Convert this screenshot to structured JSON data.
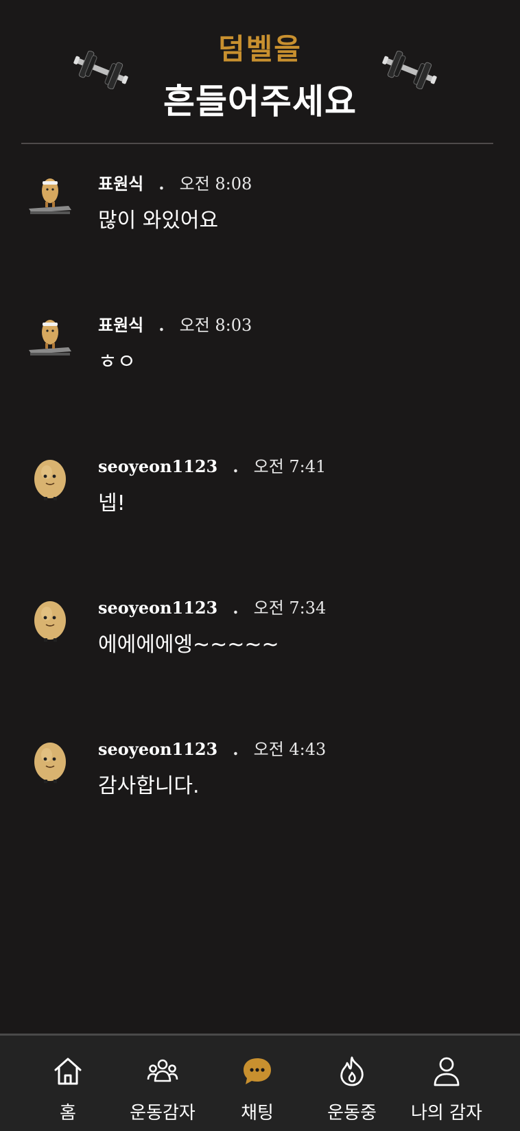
{
  "header": {
    "title_line1": "덤벨을",
    "title_line2": "흔들어주세요",
    "accent_color": "#c8902f",
    "left_icon": "dumbbell-icon",
    "right_icon": "dumbbell-icon"
  },
  "messages": [
    {
      "author": "표원식",
      "separator": ".",
      "time": "오전 8:08",
      "text": "많이 와있어요",
      "avatar": "potato-treadmill-avatar"
    },
    {
      "author": "표원식",
      "separator": ".",
      "time": "오전 8:03",
      "text": "ㅎㅇ",
      "avatar": "potato-treadmill-avatar"
    },
    {
      "author": "seoyeon1123",
      "separator": ".",
      "time": "오전 7:41",
      "text": "넵!",
      "avatar": "potato-avatar"
    },
    {
      "author": "seoyeon1123",
      "separator": ".",
      "time": "오전 7:34",
      "text": "에에에에엥~~~~~",
      "avatar": "potato-avatar"
    },
    {
      "author": "seoyeon1123",
      "separator": ".",
      "time": "오전 4:43",
      "text": "감사합니다.",
      "avatar": "potato-avatar"
    }
  ],
  "nav": {
    "items": [
      {
        "label": "홈",
        "icon": "home-icon"
      },
      {
        "label": "운동감자",
        "icon": "group-icon"
      },
      {
        "label": "채팅",
        "icon": "chat-icon",
        "active": true
      },
      {
        "label": "운동중",
        "icon": "flame-icon"
      },
      {
        "label": "나의 감자",
        "icon": "user-icon"
      }
    ],
    "active_color": "#c8902f"
  }
}
